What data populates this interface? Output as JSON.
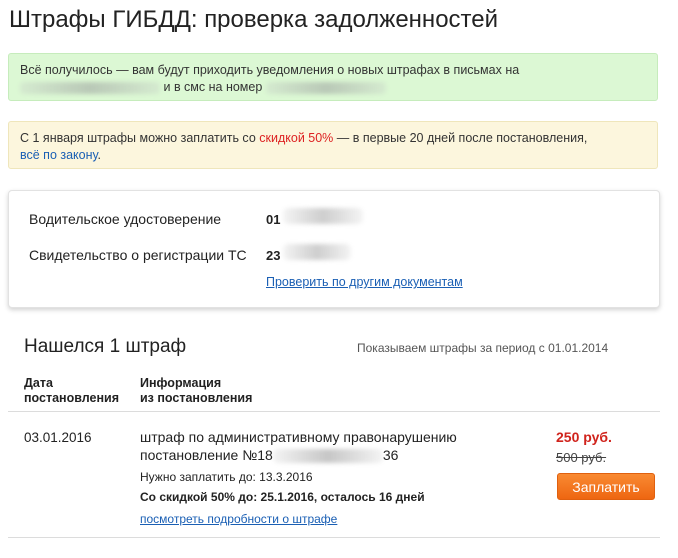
{
  "page": {
    "title": "Штрафы ГИБДД: проверка задолженностей"
  },
  "notice_success": {
    "line1": "Всё получилось — вам будут приходить уведомления о новых штрафах в письмах на",
    "line2": "и в смс на номер"
  },
  "notice_discount": {
    "before": "С 1 января штрафы можно заплатить со ",
    "highlight": "скидкой 50%",
    "after": " — в первые 20 дней после постановления,",
    "link": "всё по закону",
    "link_suffix": ".",
    "highlight_color": "#dd2222"
  },
  "documents": {
    "items": [
      {
        "label": "Водительское удостоверение",
        "value": "01"
      },
      {
        "label": "Свидетельство о регистрации ТС",
        "value": "23"
      }
    ],
    "other_link": "Проверить по другим документам"
  },
  "results": {
    "title": "Нашелся 1 штраф",
    "period": "Показываем штрафы за период с 01.01.2014",
    "columns": {
      "date_line1": "Дата",
      "date_line2": "постановления",
      "info_line1": "Информация",
      "info_line2": "из постановления"
    }
  },
  "fine": {
    "date": "03.01.2016",
    "description_line1": "штраф по административному правонарушению",
    "description_line2_prefix": "постановление №18",
    "description_line2_suffix": "36",
    "pay_until": "Нужно заплатить до: 13.3.2016",
    "discount_until": "Со скидкой 50% до: 25.1.2016, осталось 16 дней",
    "details_link": "посмотреть подробности о штрафе",
    "price_discounted": "250 руб.",
    "price_original": "500 руб.",
    "pay_button": "Заплатить"
  },
  "colors": {
    "success_bg": "#dcf8d4",
    "warning_bg": "#fcf6dd",
    "link": "#1a5fb4",
    "price_red": "#d0231c",
    "button_orange": "#f07418"
  }
}
